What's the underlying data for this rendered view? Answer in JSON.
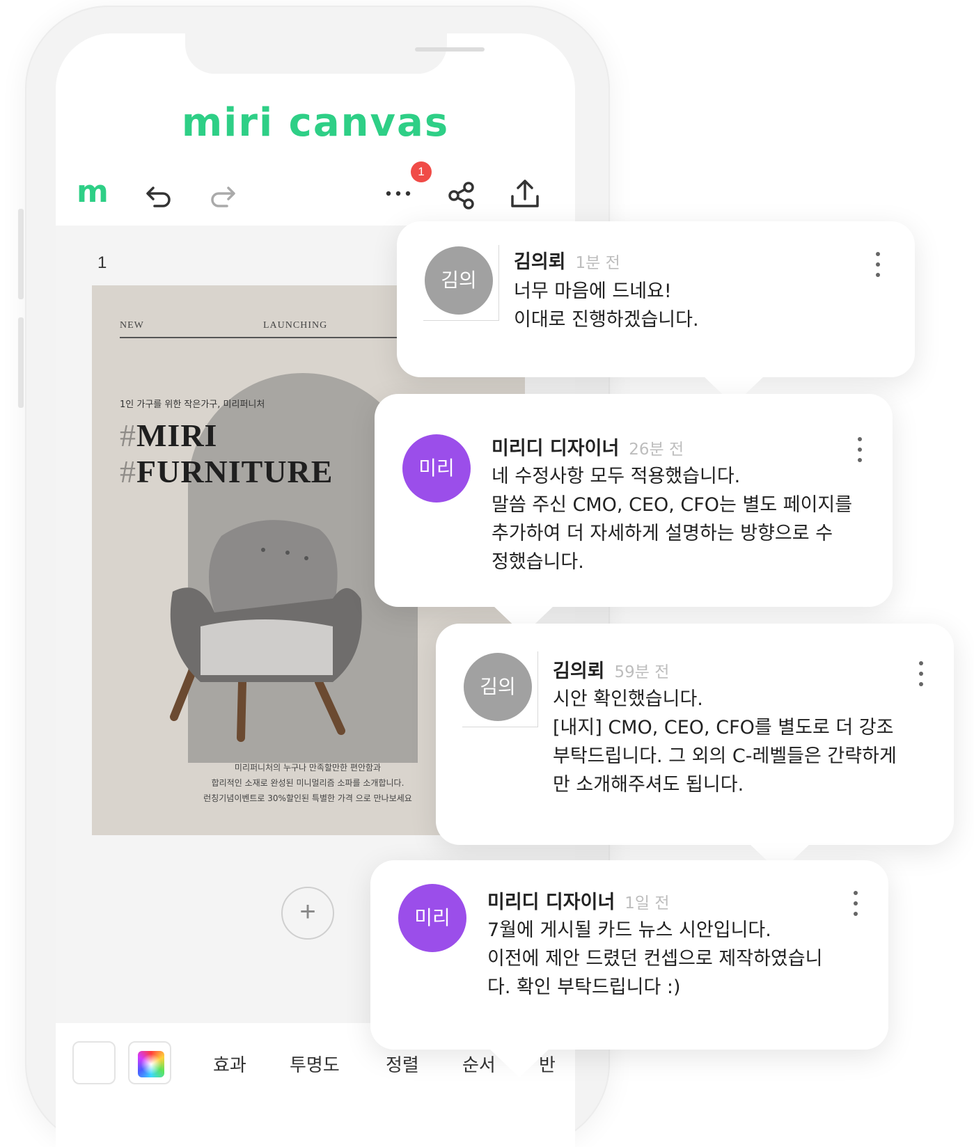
{
  "app": {
    "logo_text": "miri canvas",
    "menu_logo": "m"
  },
  "toolbar": {
    "undo_icon": "undo-icon",
    "redo_icon": "redo-icon",
    "more_icon": "more-icon",
    "notification_count": "1",
    "share_icon": "share-icon",
    "upload_icon": "upload-icon"
  },
  "editor": {
    "page_number": "1",
    "add_page_icon": "+"
  },
  "poster": {
    "new": "NEW",
    "launching": "LAUNCHING",
    "tagline": "1인 가구를 위한 작은가구, 미리퍼니처",
    "title_line1": "MIRI",
    "title_line2": "FURNITURE",
    "desc_line1": "미리퍼니처의 누구나 만족할만한 편안함과",
    "desc_line2": "합리적인 소재로 완성된 미니멀리즘 소파를 소개합니다.",
    "desc_line3": "런칭기념이벤트로 30%할인된 특별한 가격 으로 만나보세요"
  },
  "bottom_bar": {
    "items": [
      "효과",
      "투명도",
      "정렬",
      "순서",
      "반"
    ]
  },
  "comments": [
    {
      "avatar": "김의",
      "name": "김의뢰",
      "time": "1분 전",
      "text": "너무 마음에 드네요!\n이대로 진행하겠습니다."
    },
    {
      "avatar": "미리",
      "name": "미리디 디자이너",
      "time": "26분 전",
      "text": "네 수정사항 모두 적용했습니다.\n말씀 주신 CMO, CEO, CFO는 별도 페이지를\n추가하여 더 자세하게 설명하는 방향으로 수\n정했습니다."
    },
    {
      "avatar": "김의",
      "name": "김의뢰",
      "time": "59분 전",
      "text": "시안 확인했습니다.\n[내지] CMO, CEO, CFO를 별도로 더 강조\n부탁드립니다. 그 외의 C-레벨들은 간략하게\n만 소개해주셔도 됩니다."
    },
    {
      "avatar": "미리",
      "name": "미리디 디자이너",
      "time": "1일 전",
      "text": "7월에 게시될 카드 뉴스 시안입니다.\n이전에 제안 드렸던 컨셉으로 제작하였습니\n다. 확인 부탁드립니다 :)"
    }
  ],
  "colors": {
    "brand": "#2ecf86",
    "badge": "#f04b47",
    "avatar_gray": "#a1a1a1",
    "avatar_purple": "#9b4eea"
  }
}
